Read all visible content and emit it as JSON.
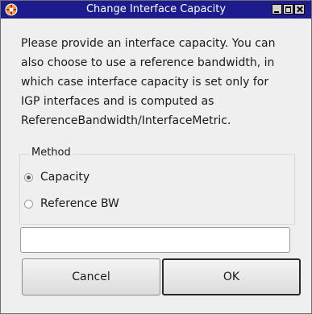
{
  "window": {
    "title": "Change Interface Capacity"
  },
  "message": "Please provide an interface capacity.  You can\nalso choose to use a reference bandwidth, in\nwhich case interface capacity is set only for\nIGP interfaces and is computed as\nReferenceBandwidth/InterfaceMetric.",
  "method": {
    "legend": "Method",
    "options": [
      {
        "label": "Capacity",
        "checked": true
      },
      {
        "label": "Reference BW",
        "checked": false
      }
    ]
  },
  "capacity_input": {
    "value": ""
  },
  "buttons": {
    "cancel": "Cancel",
    "ok": "OK"
  },
  "colors": {
    "titlebar": "#1c1c8e",
    "window_bg": "#efefef"
  },
  "icons": [
    "app-icon",
    "minimize-icon",
    "maximize-icon",
    "close-icon"
  ]
}
